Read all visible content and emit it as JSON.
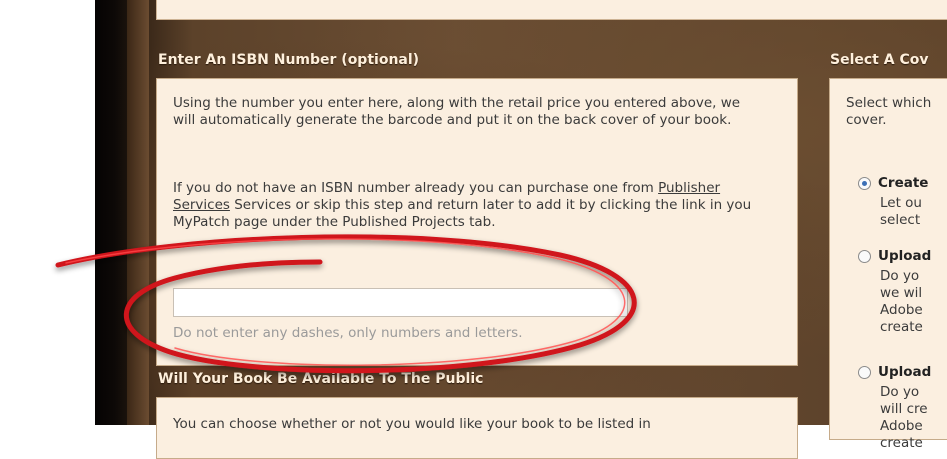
{
  "isbn_section": {
    "title": "Enter An ISBN Number (optional)",
    "para1": "Using the number you enter here, along with the retail price you entered above, we will automatically generate the barcode and put it on the back cover of your book.",
    "para2_pre": "If you do not have an ISBN number already you can purchase one from ",
    "para2_link": "Publisher Services",
    "para2_post": " Services or skip this step and return later to add it by clicking the link in you MyPatch page under the Published Projects tab.",
    "input_value": "",
    "hint": "Do not enter any dashes, only numbers and letters."
  },
  "public_section": {
    "title": "Will Your Book Be Available To The Public",
    "para": "You can choose whether or not you would like your book to be listed in"
  },
  "cover_section": {
    "title": "Select A Cov",
    "intro_line1": "Select which",
    "intro_line2": "cover.",
    "options": [
      {
        "label": "Create",
        "selected": true,
        "desc": [
          "Let ou",
          "select"
        ]
      },
      {
        "label": "Upload",
        "selected": false,
        "desc": [
          "Do yo",
          "we wil",
          "Adobe",
          "create"
        ]
      },
      {
        "label": "Upload",
        "selected": false,
        "desc": [
          "Do yo",
          "will cre",
          "Adobe",
          "create"
        ]
      }
    ]
  },
  "colors": {
    "panel_bg": "#fbefe0",
    "panel_border": "#c6ab8a",
    "background_brown": "#6a4d33",
    "annotation_red": "#d0121a",
    "radio_accent": "#3b6fb6"
  }
}
